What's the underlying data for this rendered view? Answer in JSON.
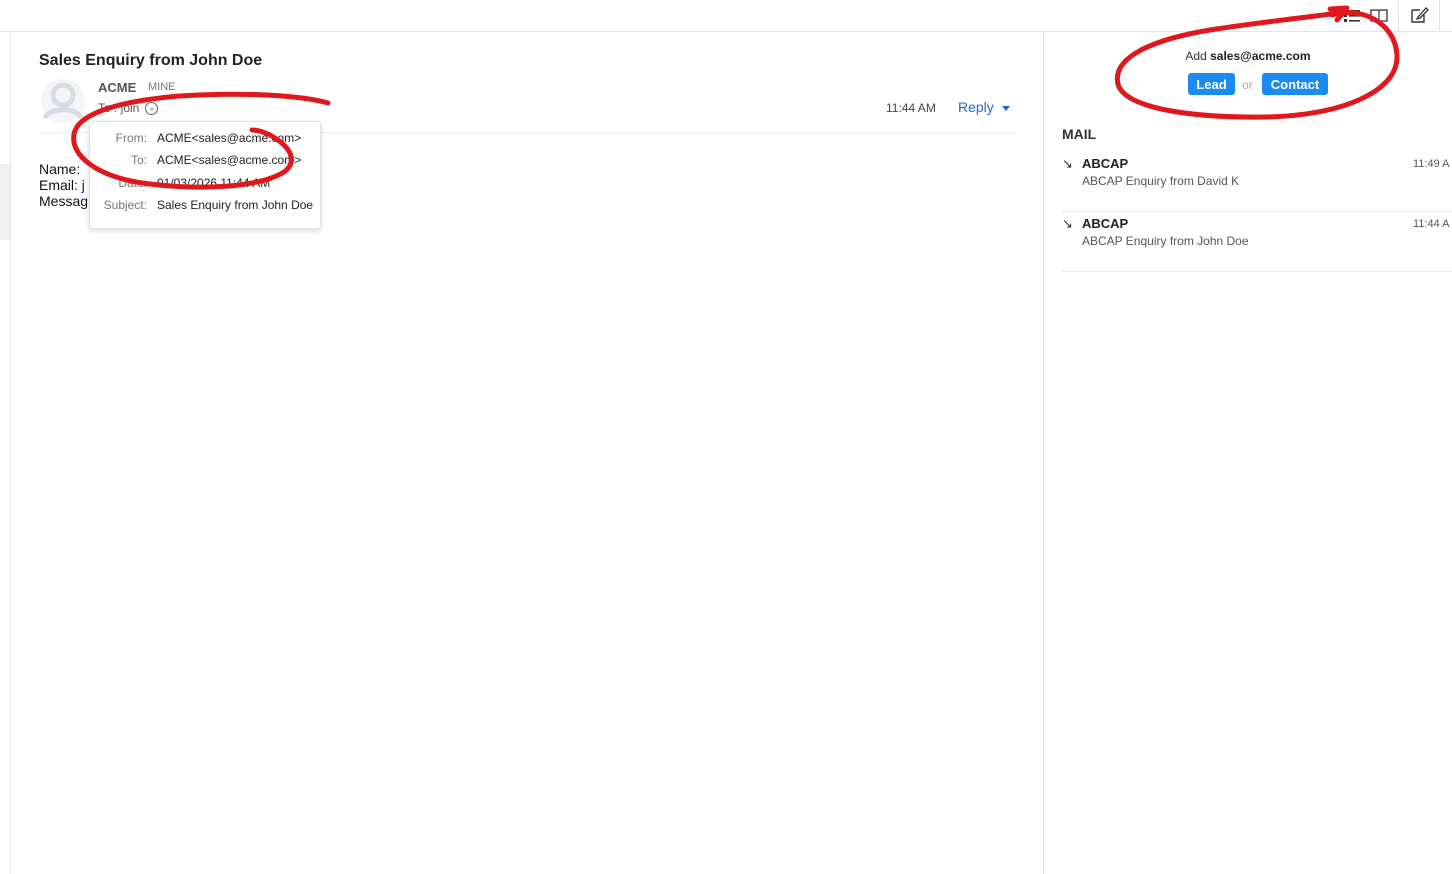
{
  "mail": {
    "subject": "Sales Enquiry from John Doe",
    "sender_name": "ACME",
    "sender_tag": "MINE",
    "to_line": "To : join",
    "time": "11:44 AM",
    "reply_label": "Reply",
    "body": {
      "name_label": "Name: ",
      "email_label": "Email: ",
      "email_value": "j",
      "message_label": "Messag"
    }
  },
  "details": {
    "from_label": "From:",
    "from_value": "ACME<sales@acme.com>",
    "to_label": "To:",
    "to_value": "ACME<sales@acme.com>",
    "date_label": "Date:",
    "date_value": "01/03/2026 11:44 AM",
    "subject_label": "Subject:",
    "subject_value": "Sales Enquiry from John Doe"
  },
  "side": {
    "add_prefix": "Add",
    "add_email": "sales@acme.com",
    "lead_label": "Lead",
    "or_label": "or",
    "contact_label": "Contact",
    "section_title": "MAIL",
    "items": [
      {
        "sender": "ABCAP",
        "subject": "ABCAP Enquiry from David K",
        "time": "11:49 A"
      },
      {
        "sender": "ABCAP",
        "subject": "ABCAP Enquiry from John Doe",
        "time": "11:44 A"
      }
    ]
  },
  "icons": {
    "toolbar": [
      "list-view-icon",
      "book-icon",
      "compose-icon"
    ],
    "direction": "incoming-arrow-icon"
  },
  "colors": {
    "accent": "#1a8cf0",
    "link": "#1f6cc8",
    "annotation": "#e0181d"
  }
}
